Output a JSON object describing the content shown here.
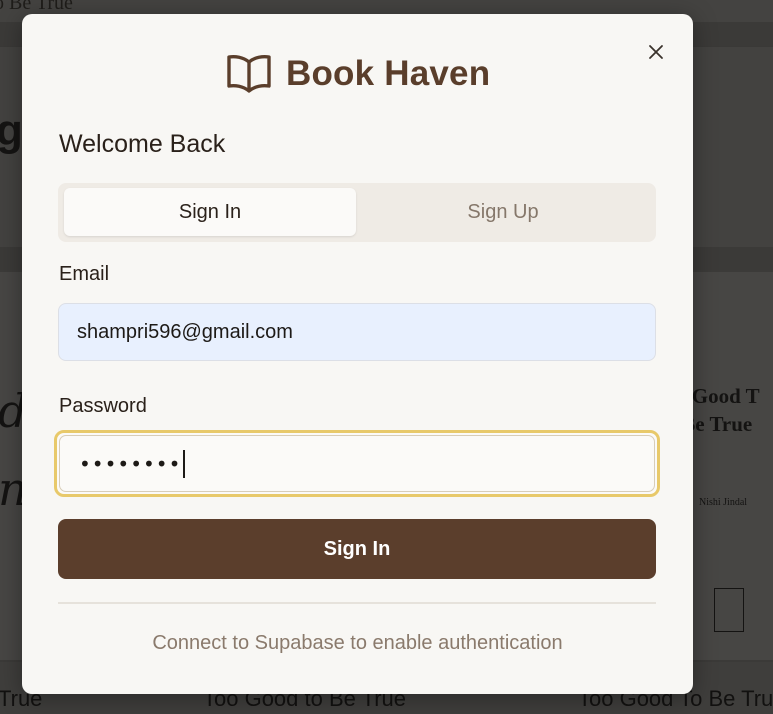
{
  "background_page": {
    "top_text": "o Be True",
    "big_letter": "g",
    "script_text": "d\nn",
    "book_title": "o Good T\nBe True",
    "book_author": "Nishi Jindal",
    "bottom_titles": [
      "True",
      "Too Good to Be True",
      "Too Good To Be True"
    ]
  },
  "modal": {
    "brand": {
      "title": "Book Haven",
      "icon": "book-open-icon"
    },
    "close_icon": "close-icon",
    "heading": "Welcome Back",
    "tabs": [
      {
        "label": "Sign In",
        "active": true
      },
      {
        "label": "Sign Up",
        "active": false
      }
    ],
    "email": {
      "label": "Email",
      "value": "shampri596@gmail.com"
    },
    "password": {
      "label": "Password",
      "masked_value": "••••••••"
    },
    "submit_label": "Sign In",
    "footer_note": "Connect to Supabase to enable authentication"
  },
  "colors": {
    "brand_brown": "#5a3e2b",
    "button_brown": "#5b3e2c",
    "focus_ring": "#e8c96a",
    "autofill_blue": "#e8f0fe",
    "modal_bg": "#f8f7f4"
  }
}
